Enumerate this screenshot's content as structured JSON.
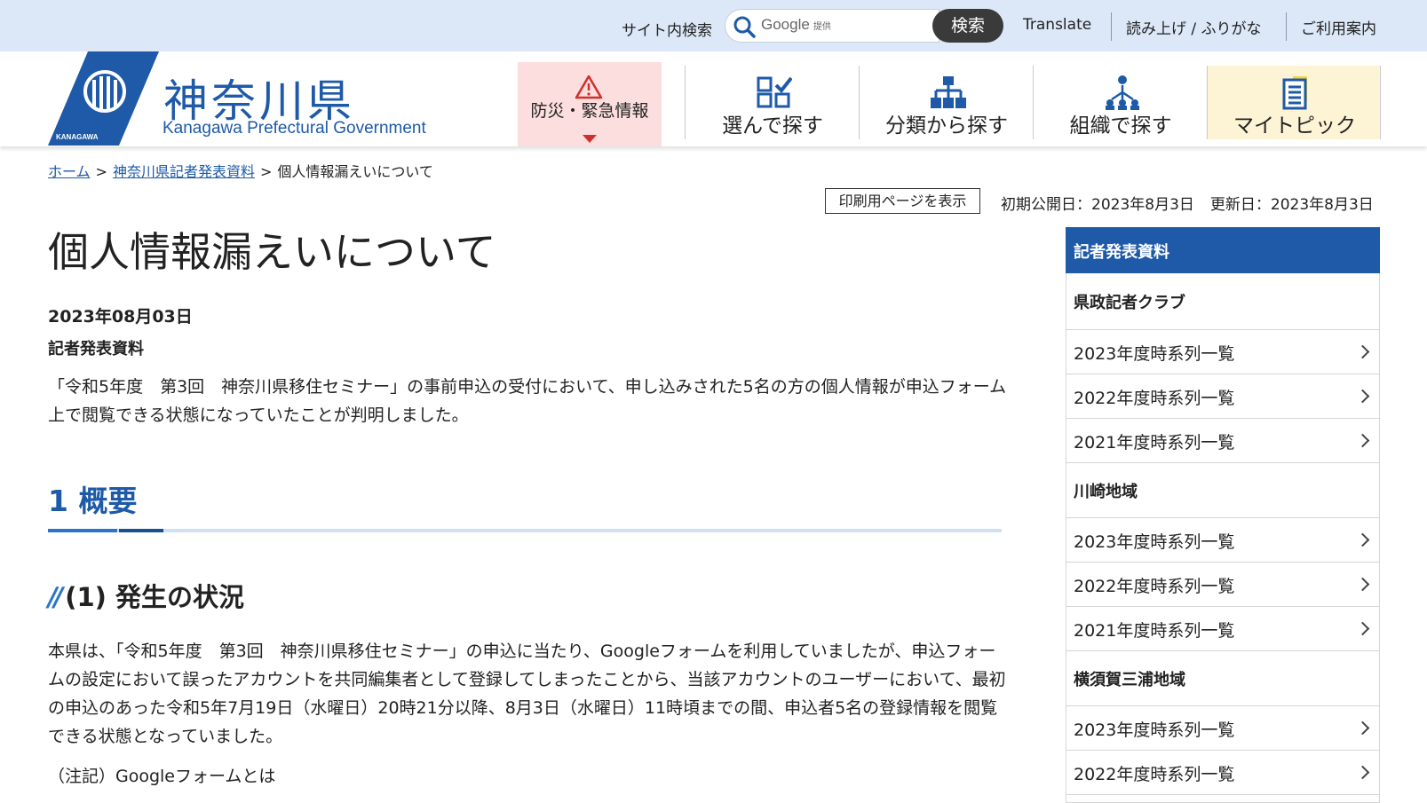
{
  "topbar": {
    "search_label": "サイト内検索",
    "search_provider": "Google",
    "search_provider_sub": "提供",
    "search_button": "検索",
    "translate": "Translate",
    "read_aloud": "読み上げ / ふりがな",
    "guide": "ご利用案内"
  },
  "header": {
    "logo_ja": "神奈川県",
    "logo_en": "Kanagawa Prefectural Government",
    "logo_badge": "KANAGAWA",
    "nav": {
      "disaster": "防災・緊急情報",
      "choose": "選んで探す",
      "category": "分類から探す",
      "organization": "組織で探す",
      "mytopic": "マイトピック"
    }
  },
  "breadcrumb": {
    "home": "ホーム",
    "sep": ">",
    "section": "神奈川県記者発表資料",
    "current": "個人情報漏えいについて"
  },
  "meta": {
    "print": "印刷用ページを表示",
    "first_published": "初期公開日：2023年8月3日",
    "updated": "更新日：2023年8月3日"
  },
  "article": {
    "title": "個人情報漏えいについて",
    "date": "2023年08月03日",
    "type": "記者発表資料",
    "lead": "「令和5年度　第3回　神奈川県移住セミナー」の事前申込の受付において、申し込みされた5名の方の個人情報が申込フォーム上で閲覧できる状態になっていたことが判明しました。",
    "h2": "1 概要",
    "h3": "(1) 発生の状況",
    "body": "本県は、「令和5年度　第3回　神奈川県移住セミナー」の申込に当たり、Googleフォームを利用していましたが、申込フォームの設定において誤ったアカウントを共同編集者として登録してしまったことから、当該アカウントのユーザーにおいて、最初の申込のあった令和5年7月19日（水曜日）20時21分以降、8月3日（水曜日）11時頃までの間、申込者5名の登録情報を閲覧できる状態となっていました。",
    "note": "（注記）Googleフォームとは"
  },
  "sidebar": {
    "heading": "記者発表資料",
    "groups": [
      {
        "name": "県政記者クラブ",
        "items": [
          "2023年度時系列一覧",
          "2022年度時系列一覧",
          "2021年度時系列一覧"
        ]
      },
      {
        "name": "川崎地域",
        "items": [
          "2023年度時系列一覧",
          "2022年度時系列一覧",
          "2021年度時系列一覧"
        ]
      },
      {
        "name": "横須賀三浦地域",
        "items": [
          "2023年度時系列一覧",
          "2022年度時系列一覧"
        ]
      }
    ]
  },
  "colors": {
    "brand_blue": "#1e5aa8",
    "topbar_bg": "#dce8f8",
    "disaster_bg": "#fbdedd",
    "mytopic_bg": "#fdf4d6"
  }
}
